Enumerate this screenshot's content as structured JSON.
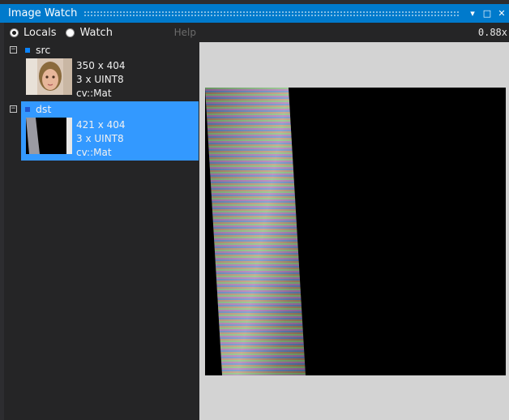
{
  "window": {
    "title": "Image Watch"
  },
  "title_buttons": {
    "dropdown": "▾",
    "maximize": "□",
    "close": "✕"
  },
  "modes": {
    "locals_label": "Locals",
    "watch_label": "Watch",
    "selected": "Locals"
  },
  "help_label": "Help",
  "zoom": "0.88x",
  "items": [
    {
      "expander": "⊟",
      "name": "src",
      "size": "350 x 404",
      "type": "3 x UINT8",
      "class": "cv::Mat",
      "selected": false
    },
    {
      "expander": "⊟",
      "name": "dst",
      "size": "421 x 404",
      "type": "3 x UINT8",
      "class": "cv::Mat",
      "selected": true
    }
  ],
  "colors": {
    "accent": "#007acc",
    "selection": "#3399ff",
    "panel": "#252526",
    "viewer_bg": "#d3d3d3"
  }
}
